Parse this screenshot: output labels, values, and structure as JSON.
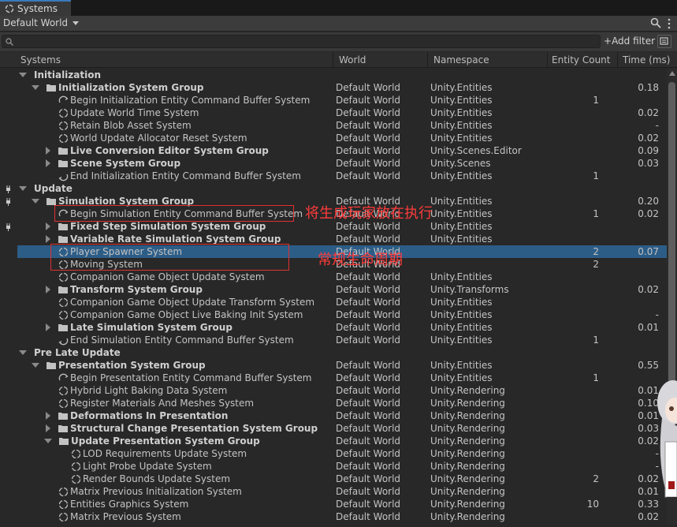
{
  "window": {
    "tab_title": "Systems"
  },
  "toolbar": {
    "world_dropdown": "Default World"
  },
  "search": {
    "placeholder": "",
    "add_filter_label": "Add filter"
  },
  "columns": {
    "systems": "Systems",
    "world": "World",
    "namespace": "Namespace",
    "entity_count": "Entity Count",
    "time": "Time (ms)"
  },
  "colors": {
    "selected_row": "#2c5d87",
    "annotation_red": "#e03030",
    "accent_tab": "#3a79bb"
  },
  "annotations": [
    {
      "text": "将生成玩家放在执行"
    },
    {
      "text": "常规生命周期"
    }
  ],
  "rows": [
    {
      "name": "Initialization",
      "indent": 0,
      "kind": "header",
      "arrow": "expanded",
      "world": "",
      "namespace": "",
      "count": "",
      "time": ""
    },
    {
      "name": "Initialization System Group",
      "indent": 1,
      "kind": "group",
      "arrow": "expanded",
      "world": "Default World",
      "namespace": "Unity.Entities",
      "count": "",
      "time": "0.18"
    },
    {
      "name": "Begin Initialization Entity Command Buffer System",
      "indent": 2,
      "kind": "ecb",
      "world": "Default World",
      "namespace": "Unity.Entities",
      "count": "1",
      "time": ""
    },
    {
      "name": "Update World Time System",
      "indent": 2,
      "kind": "system",
      "world": "Default World",
      "namespace": "Unity.Entities",
      "count": "",
      "time": "0.02"
    },
    {
      "name": "Retain Blob Asset System",
      "indent": 2,
      "kind": "system",
      "world": "Default World",
      "namespace": "Unity.Entities",
      "count": "",
      "time": "-"
    },
    {
      "name": "World Update Allocator Reset System",
      "indent": 2,
      "kind": "system",
      "world": "Default World",
      "namespace": "Unity.Entities",
      "count": "",
      "time": "0.02"
    },
    {
      "name": "Live Conversion Editor System Group",
      "indent": 2,
      "kind": "group",
      "arrow": "collapsed",
      "world": "Default World",
      "namespace": "Unity.Scenes.Editor",
      "count": "",
      "time": "0.09"
    },
    {
      "name": "Scene System Group",
      "indent": 2,
      "kind": "group",
      "arrow": "collapsed",
      "world": "Default World",
      "namespace": "Unity.Scenes",
      "count": "",
      "time": "0.03"
    },
    {
      "name": "End Initialization Entity Command Buffer System",
      "indent": 2,
      "kind": "ecb2",
      "world": "Default World",
      "namespace": "Unity.Entities",
      "count": "1",
      "time": ""
    },
    {
      "name": "Update",
      "indent": 0,
      "kind": "header",
      "arrow": "expanded",
      "world": "",
      "namespace": "",
      "count": "",
      "time": ""
    },
    {
      "name": "Simulation System Group",
      "indent": 1,
      "kind": "group",
      "arrow": "expanded",
      "world": "Default World",
      "namespace": "Unity.Entities",
      "count": "",
      "time": "0.20"
    },
    {
      "name": "Begin Simulation Entity Command Buffer System",
      "indent": 2,
      "kind": "ecb",
      "world": "Default World",
      "namespace": "Unity.Entities",
      "count": "1",
      "time": "0.02"
    },
    {
      "name": "Fixed Step Simulation System Group",
      "indent": 2,
      "kind": "group",
      "arrow": "collapsed",
      "world": "Default World",
      "namespace": "Unity.Entities",
      "count": "",
      "time": ""
    },
    {
      "name": "Variable Rate Simulation System Group",
      "indent": 2,
      "kind": "group",
      "arrow": "collapsed",
      "world": "Default World",
      "namespace": "Unity.Entities",
      "count": "",
      "time": ""
    },
    {
      "name": "Player Spawner System",
      "indent": 2,
      "kind": "system",
      "world": "Default World",
      "namespace": "",
      "count": "2",
      "time": "0.07",
      "selected": true
    },
    {
      "name": "Moving System",
      "indent": 2,
      "kind": "system",
      "world": "Default World",
      "namespace": "",
      "count": "2",
      "time": ""
    },
    {
      "name": "Companion Game Object Update System",
      "indent": 2,
      "kind": "system",
      "world": "Default World",
      "namespace": "Unity.Entities",
      "count": "",
      "time": ""
    },
    {
      "name": "Transform System Group",
      "indent": 2,
      "kind": "group",
      "arrow": "collapsed",
      "world": "Default World",
      "namespace": "Unity.Transforms",
      "count": "",
      "time": "0.02"
    },
    {
      "name": "Companion Game Object Update Transform System",
      "indent": 2,
      "kind": "system",
      "world": "Default World",
      "namespace": "Unity.Entities",
      "count": "",
      "time": ""
    },
    {
      "name": "Companion Game Object Live Baking Init System",
      "indent": 2,
      "kind": "system",
      "world": "Default World",
      "namespace": "Unity.Entities",
      "count": "",
      "time": "-"
    },
    {
      "name": "Late Simulation System Group",
      "indent": 2,
      "kind": "group",
      "arrow": "collapsed",
      "world": "Default World",
      "namespace": "Unity.Entities",
      "count": "",
      "time": "0.01"
    },
    {
      "name": "End Simulation Entity Command Buffer System",
      "indent": 2,
      "kind": "ecb2",
      "world": "Default World",
      "namespace": "Unity.Entities",
      "count": "1",
      "time": ""
    },
    {
      "name": "Pre Late Update",
      "indent": 0,
      "kind": "header",
      "arrow": "expanded",
      "world": "",
      "namespace": "",
      "count": "",
      "time": ""
    },
    {
      "name": "Presentation System Group",
      "indent": 1,
      "kind": "group",
      "arrow": "expanded",
      "world": "Default World",
      "namespace": "Unity.Entities",
      "count": "",
      "time": "0.55"
    },
    {
      "name": "Begin Presentation Entity Command Buffer System",
      "indent": 2,
      "kind": "ecb",
      "world": "Default World",
      "namespace": "Unity.Entities",
      "count": "1",
      "time": ""
    },
    {
      "name": "Hybrid Light Baking Data System",
      "indent": 2,
      "kind": "system",
      "world": "Default World",
      "namespace": "Unity.Rendering",
      "count": "",
      "time": "0.01"
    },
    {
      "name": "Register Materials And Meshes System",
      "indent": 2,
      "kind": "system",
      "world": "Default World",
      "namespace": "Unity.Rendering",
      "count": "",
      "time": "0.10"
    },
    {
      "name": "Deformations In Presentation",
      "indent": 2,
      "kind": "group",
      "arrow": "collapsed",
      "world": "Default World",
      "namespace": "Unity.Rendering",
      "count": "",
      "time": "0.01"
    },
    {
      "name": "Structural Change Presentation System Group",
      "indent": 2,
      "kind": "group",
      "arrow": "collapsed",
      "world": "Default World",
      "namespace": "Unity.Rendering",
      "count": "",
      "time": "0.03"
    },
    {
      "name": "Update Presentation System Group",
      "indent": 2,
      "kind": "group",
      "arrow": "expanded",
      "world": "Default World",
      "namespace": "Unity.Rendering",
      "count": "",
      "time": "0.02"
    },
    {
      "name": "LOD Requirements Update System",
      "indent": 3,
      "kind": "system",
      "world": "Default World",
      "namespace": "Unity.Rendering",
      "count": "",
      "time": "-"
    },
    {
      "name": "Light Probe Update System",
      "indent": 3,
      "kind": "system",
      "world": "Default World",
      "namespace": "Unity.Rendering",
      "count": "",
      "time": "-"
    },
    {
      "name": "Render Bounds Update System",
      "indent": 3,
      "kind": "system",
      "world": "Default World",
      "namespace": "Unity.Rendering",
      "count": "2",
      "time": "0.02"
    },
    {
      "name": "Matrix Previous Initialization System",
      "indent": 2,
      "kind": "system",
      "world": "Default World",
      "namespace": "Unity.Rendering",
      "count": "",
      "time": "0.01"
    },
    {
      "name": "Entities Graphics System",
      "indent": 2,
      "kind": "system",
      "world": "Default World",
      "namespace": "Unity.Rendering",
      "count": "10",
      "time": "0.33"
    },
    {
      "name": "Matrix Previous System",
      "indent": 2,
      "kind": "system",
      "world": "Default World",
      "namespace": "Unity.Rendering",
      "count": "",
      "time": "0.02"
    }
  ]
}
